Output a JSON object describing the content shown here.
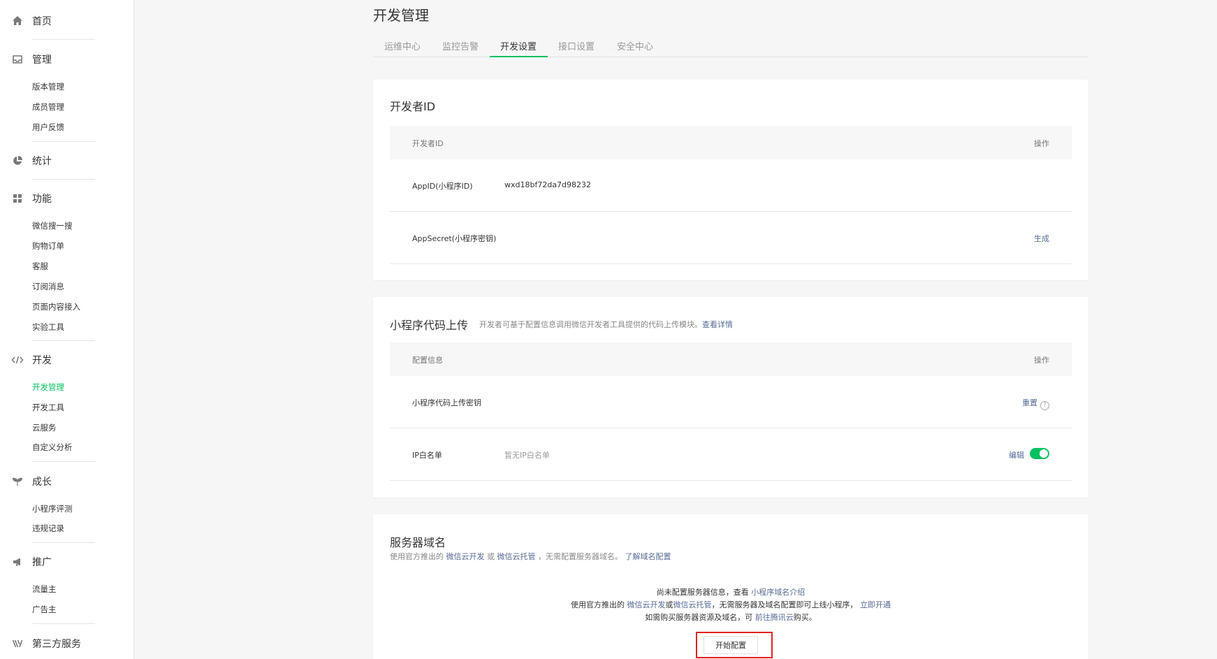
{
  "sidebar": {
    "home": {
      "label": "首页",
      "icon": "home-icon"
    },
    "manage": {
      "label": "管理",
      "icon": "inbox-icon",
      "items": [
        "版本管理",
        "成员管理",
        "用户反馈"
      ]
    },
    "stats": {
      "label": "统计",
      "icon": "pie-chart-icon"
    },
    "features": {
      "label": "功能",
      "icon": "grid-icon",
      "items": [
        "微信搜一搜",
        "购物订单",
        "客服",
        "订阅消息",
        "页面内容接入",
        "实验工具"
      ]
    },
    "dev": {
      "label": "开发",
      "icon": "code-icon",
      "items": [
        "开发管理",
        "开发工具",
        "云服务",
        "自定义分析"
      ],
      "active_item": "开发管理"
    },
    "growth": {
      "label": "成长",
      "icon": "sprout-icon",
      "items": [
        "小程序评测",
        "违规记录"
      ]
    },
    "promo": {
      "label": "推广",
      "icon": "megaphone-icon",
      "items": [
        "流量主",
        "广告主"
      ]
    },
    "third": {
      "label": "第三方服务",
      "icon": "third-party-icon"
    }
  },
  "page": {
    "title": "开发管理",
    "tabs": [
      "运维中心",
      "监控告警",
      "开发设置",
      "接口设置",
      "安全中心"
    ],
    "active_tab": "开发设置"
  },
  "dev_id_card": {
    "title": "开发者ID",
    "header": {
      "col1": "开发者ID",
      "col_op": "操作"
    },
    "rows": [
      {
        "label": "AppID(小程序ID)",
        "value": "wxd18bf72da7d98232",
        "op": ""
      },
      {
        "label": "AppSecret(小程序密钥)",
        "value": "",
        "op": "生成"
      }
    ]
  },
  "upload_card": {
    "title": "小程序代码上传",
    "desc": "开发者可基于配置信息调用微信开发者工具提供的代码上传模块。",
    "desc_link": "查看详情",
    "header": {
      "col1": "配置信息",
      "col_op": "操作"
    },
    "rows": [
      {
        "label": "小程序代码上传密钥",
        "value": "",
        "op": "重置"
      },
      {
        "label": "IP白名单",
        "value": "暂无IP白名单",
        "op": "编辑",
        "toggle_on": true
      }
    ]
  },
  "server_card": {
    "title": "服务器域名",
    "desc_prefix": "使用官方推出的",
    "desc_link1": "微信云开发",
    "desc_or": "或",
    "desc_link2": "微信云托管",
    "desc_mid": "，无需配置服务器域名。",
    "desc_link3": "了解域名配置",
    "line1_prefix": "尚未配置服务器信息，查看",
    "line1_link": "小程序域名介绍",
    "line2_prefix": "使用官方推出的",
    "line2_link1": "微信云开发",
    "line2_or": "或",
    "line2_link2": "微信云托管",
    "line2_mid": "，无需服务器及域名配置即可上线小程序，",
    "line2_link3": "立即开通",
    "line3_prefix": "如需购买服务器资源及域名，可",
    "line3_link": "前往腾讯云",
    "line3_suffix": "购买。",
    "button": "开始配置"
  },
  "colors": {
    "accent": "#07c160",
    "link": "#576b95",
    "highlight": "#e02020"
  }
}
